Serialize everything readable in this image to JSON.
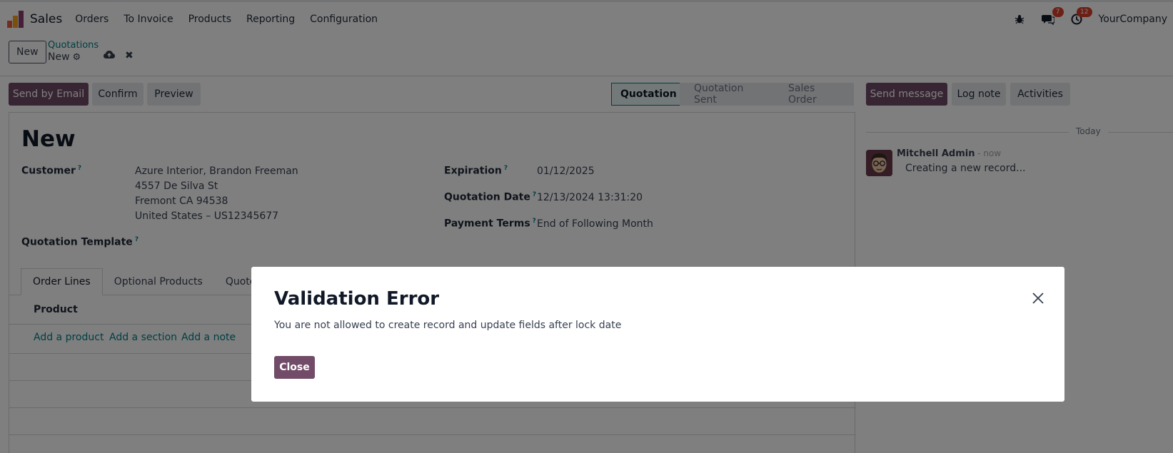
{
  "app": {
    "name": "Sales",
    "menu": [
      "Orders",
      "To Invoice",
      "Products",
      "Reporting",
      "Configuration"
    ],
    "company": "YourCompany",
    "messages_count": "7",
    "activities_count": "12"
  },
  "control": {
    "new_button": "New",
    "breadcrumb_parent": "Quotations",
    "breadcrumb_current": "New"
  },
  "actions": {
    "send_by_email": "Send by Email",
    "confirm": "Confirm",
    "preview": "Preview"
  },
  "status_stages": [
    "Quotation",
    "Quotation Sent",
    "Sales Order"
  ],
  "form": {
    "title": "New",
    "customer_label": "Customer",
    "customer_lines": [
      "Azure Interior, Brandon Freeman",
      "4557 De Silva St",
      "Fremont CA 94538",
      "United States – US12345677"
    ],
    "template_label": "Quotation Template",
    "expiration_label": "Expiration",
    "expiration_value": "01/12/2025",
    "quotation_date_label": "Quotation Date",
    "quotation_date_value": "12/13/2024 13:31:20",
    "payment_terms_label": "Payment Terms",
    "payment_terms_value": "End of Following Month",
    "help_mark": "?"
  },
  "tabs": [
    "Order Lines",
    "Optional Products",
    "Quote B"
  ],
  "order_lines": {
    "column_product": "Product",
    "add_product": "Add a product",
    "add_section": "Add a section",
    "add_note": "Add a note"
  },
  "chatter": {
    "send_message": "Send message",
    "log_note": "Log note",
    "activities": "Activities",
    "today": "Today",
    "author": "Mitchell Admin",
    "time": " - now",
    "body": "Creating a new record..."
  },
  "dialog": {
    "title": "Validation Error",
    "message": "You are not allowed to create record and update fields after lock date",
    "close_button": "Close"
  },
  "colors": {
    "brand": "#714b67",
    "link": "#017e84",
    "badge": "#d9412b"
  }
}
